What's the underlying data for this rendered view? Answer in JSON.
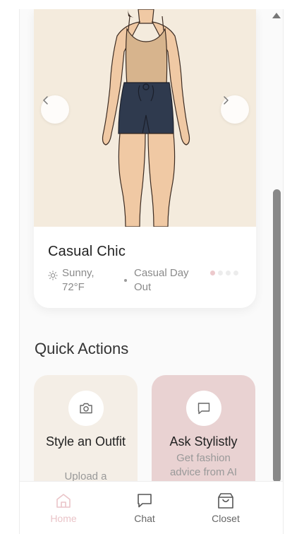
{
  "outfit": {
    "title": "Casual Chic",
    "weather": "Sunny, 72°F",
    "occasion": "Casual Day Out",
    "slide_count": 4,
    "active_slide": 0
  },
  "quick_actions": {
    "title": "Quick Actions",
    "items": [
      {
        "title": "Style an Outfit",
        "description": "Upload a",
        "icon": "camera-icon"
      },
      {
        "title": "Ask Stylistly",
        "description": "Get fashion advice from AI",
        "icon": "chat-bubble-icon"
      }
    ]
  },
  "nav": {
    "items": [
      {
        "label": "Home",
        "icon": "home-icon",
        "active": true
      },
      {
        "label": "Chat",
        "icon": "chat-icon",
        "active": false
      },
      {
        "label": "Closet",
        "icon": "shopping-bag-icon",
        "active": false
      }
    ]
  },
  "colors": {
    "accent": "#eac4c8",
    "image_background": "#f4ebdd",
    "style_card": "#f4eee6",
    "ask_card": "#e9d2d2"
  }
}
